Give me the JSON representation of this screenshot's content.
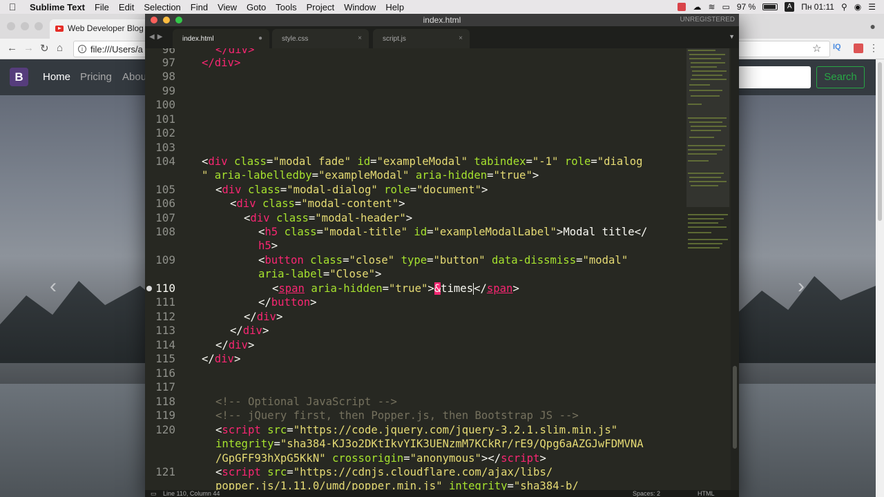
{
  "menubar": {
    "app": "Sublime Text",
    "items": [
      "File",
      "Edit",
      "Selection",
      "Find",
      "View",
      "Goto",
      "Tools",
      "Project",
      "Window",
      "Help"
    ],
    "battery": "97 %",
    "clock": "Пн 01:11"
  },
  "browser": {
    "tab_title": "Web Developer Blog -",
    "address": "file:///Users/a",
    "site": {
      "brand": "B",
      "nav": [
        "Home",
        "Pricing",
        "Abou"
      ],
      "search_button": "Search"
    }
  },
  "sublime": {
    "window_title": "index.html",
    "license": "UNREGISTERED",
    "tabs": [
      {
        "label": "index.html",
        "close": "●"
      },
      {
        "label": "style.css",
        "close": "×"
      },
      {
        "label": "script.js",
        "close": "×"
      }
    ],
    "line_numbers": [
      "96",
      "97",
      "98",
      "99",
      "100",
      "101",
      "102",
      "103",
      "104",
      "",
      "105",
      "106",
      "107",
      "108",
      "",
      "109",
      "",
      "110",
      "111",
      "112",
      "113",
      "114",
      "115",
      "116",
      "117",
      "118",
      "119",
      "120",
      "",
      "",
      "121",
      ""
    ],
    "status": {
      "position": "Line 110, Column 44",
      "spaces": "Spaces: 2",
      "syntax": "HTML"
    }
  },
  "code": {
    "l96": "</div>",
    "l97": "</div>",
    "l104_lt": "<",
    "l104_tag": "div",
    "l104_a1": "class",
    "l104_v1": "\"modal fade\"",
    "l104_a2": "id",
    "l104_v2": "\"exampleModal\"",
    "l104_a3": "tabindex",
    "l104_v3": "\"-1\"",
    "l104_a4": "role",
    "l104_v4": "\"dialog",
    "l104b_v": "\"",
    "l104b_a1": "aria-labelledby",
    "l104b_v1": "\"exampleModal\"",
    "l104b_a2": "aria-hidden",
    "l104b_v2": "\"true\"",
    "l105_tag": "div",
    "l105_a1": "class",
    "l105_v1": "\"modal-dialog\"",
    "l105_a2": "role",
    "l105_v2": "\"document\"",
    "l106_tag": "div",
    "l106_a1": "class",
    "l106_v1": "\"modal-content\"",
    "l107_tag": "div",
    "l107_a1": "class",
    "l107_v1": "\"modal-header\"",
    "l108_tag": "h5",
    "l108_a1": "class",
    "l108_v1": "\"modal-title\"",
    "l108_a2": "id",
    "l108_v2": "\"exampleModalLabel\"",
    "l108_text": "Modal title",
    "l108b_tag": "h5",
    "l109_tag": "button",
    "l109_a1": "class",
    "l109_v1": "\"close\"",
    "l109_a2": "type",
    "l109_v2": "\"button\"",
    "l109_a3": "data-dissmiss",
    "l109_v3": "\"modal\"",
    "l109b_a": "aria-label",
    "l109b_v": "\"Close\"",
    "l110_tag": "span",
    "l110_a": "aria-hidden",
    "l110_v": "\"true\"",
    "l110_amp": "&",
    "l110_ent": "times",
    "l110_ctag": "span",
    "l111_tag": "button",
    "l112_tag": "div",
    "l113_tag": "div",
    "l114_tag": "div",
    "l115_tag": "div",
    "l118": "<!-- Optional JavaScript -->",
    "l119": "<!-- jQuery first, then Popper.js, then Bootstrap JS -->",
    "l120_tag": "script",
    "l120_a": "src",
    "l120_v": "\"https://code.jquery.com/jquery-3.2.1.slim.min.js\"",
    "l120b_a": "integrity",
    "l120b_v": "\"sha384-KJ3o2DKtIkvYIK3UENzmM7KCkRr/rE9/Qpg6aAZGJwFDMVNA",
    "l120c_v": "/GpGFF93hXpG5KkN\"",
    "l120c_a": "crossorigin",
    "l120c_v2": "\"anonymous\"",
    "l120c_ctag": "script",
    "l121_tag": "script",
    "l121_a": "src",
    "l121_v": "\"https://cdnjs.cloudflare.com/ajax/libs/",
    "l121b_v": "popper.js/1.11.0/umd/popper.min.js\"",
    "l121b_a": "integrity",
    "l121b_v2": "\"sha384-b/"
  }
}
